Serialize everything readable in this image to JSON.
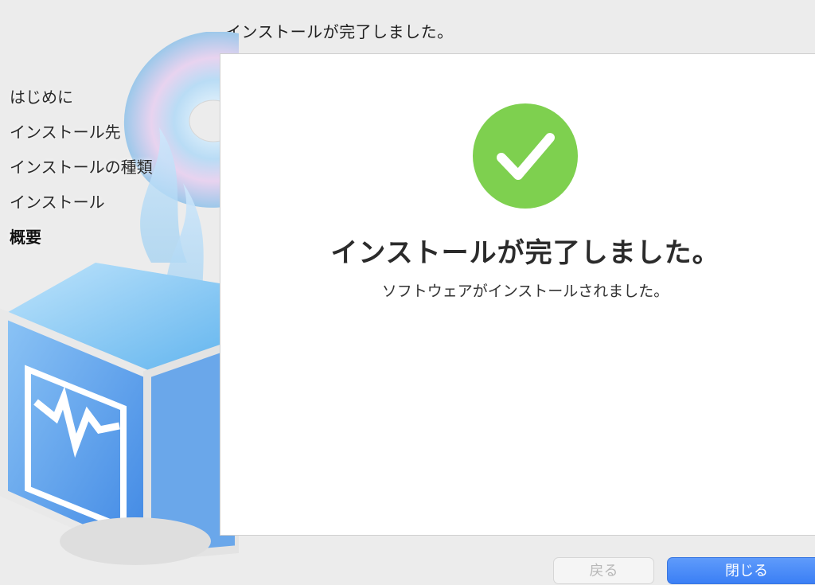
{
  "window": {
    "title": "インストールが完了しました。"
  },
  "sidebar": {
    "steps": [
      {
        "label": "はじめに"
      },
      {
        "label": "インストール先"
      },
      {
        "label": "インストールの種類"
      },
      {
        "label": "インストール"
      },
      {
        "label": "概要"
      }
    ],
    "current_step": "概要"
  },
  "main": {
    "status_icon": "checkmark-icon",
    "headline": "インストールが完了しました。",
    "message": "ソフトウェアがインストールされました。"
  },
  "buttons": {
    "back_label": "戻る",
    "close_label": "閉じる"
  },
  "colors": {
    "success": "#7ed04f",
    "accent": "#3b7ff5"
  }
}
